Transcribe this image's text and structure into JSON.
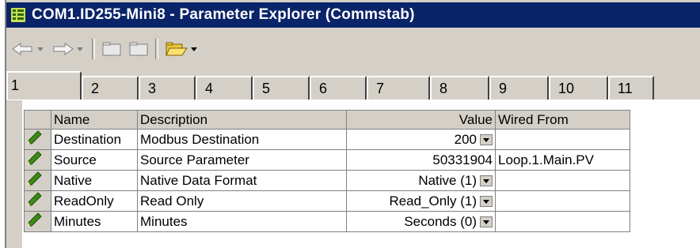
{
  "window": {
    "title": "COM1.ID255-Mini8 - Parameter Explorer (Commstab)"
  },
  "icons": {
    "app": "grid-icon",
    "back": "back-arrow-icon",
    "forward": "forward-arrow-icon",
    "folder1": "folder-icon",
    "folder2": "folder-icon",
    "open_folder": "open-folder-icon",
    "row_edit": "pencil-icon"
  },
  "tabs": [
    "1",
    "2",
    "3",
    "4",
    "5",
    "6",
    "7",
    "8",
    "9",
    "10",
    "11"
  ],
  "active_tab": "1",
  "table": {
    "headers": {
      "name": "Name",
      "description": "Description",
      "value": "Value",
      "wired_from": "Wired From"
    },
    "rows": [
      {
        "name": "Destination",
        "description": "Modbus Destination",
        "value": "200",
        "wired_from": ""
      },
      {
        "name": "Source",
        "description": "Source Parameter",
        "value": "50331904",
        "wired_from": "Loop.1.Main.PV"
      },
      {
        "name": "Native",
        "description": "Native Data Format",
        "value": "Native (1)",
        "wired_from": ""
      },
      {
        "name": "ReadOnly",
        "description": "Read Only",
        "value": "Read_Only (1)",
        "wired_from": ""
      },
      {
        "name": "Minutes",
        "description": "Minutes",
        "value": "Seconds (0)",
        "wired_from": ""
      }
    ]
  },
  "colors": {
    "titlebar": "#0a246a",
    "chrome": "#d4d0c8",
    "pencil": "#3c8c14"
  }
}
